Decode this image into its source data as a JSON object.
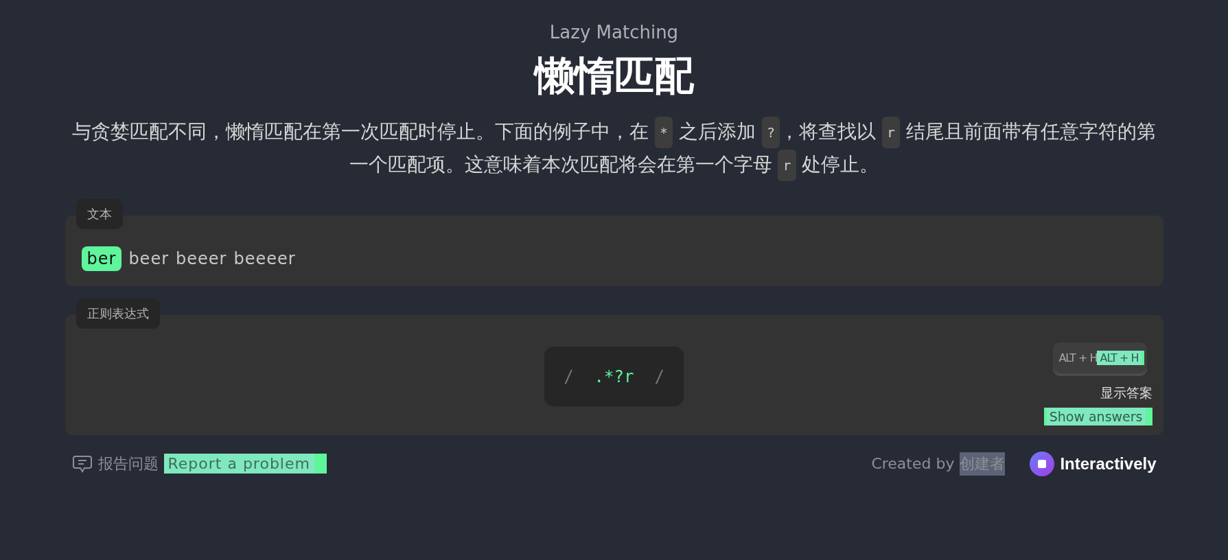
{
  "header": {
    "subtitle": "Lazy Matching",
    "title": "懒惰匹配",
    "description": [
      {
        "kind": "text",
        "text": "与贪婪匹配不同，懒惰匹配在第一次匹配时停止。下面的例子中，在 "
      },
      {
        "kind": "code",
        "text": "*"
      },
      {
        "kind": "text",
        "text": " 之后添加 "
      },
      {
        "kind": "code",
        "text": "?"
      },
      {
        "kind": "text",
        "text": "，将查找以 "
      },
      {
        "kind": "code",
        "text": "r"
      },
      {
        "kind": "text",
        "text": " 结尾且前面带有任意字符的第一个匹配项。这意味着本次匹配将会在第一个字母 "
      },
      {
        "kind": "code",
        "text": "r"
      },
      {
        "kind": "text",
        "text": " 处停止。"
      }
    ]
  },
  "text_panel": {
    "label": "文本",
    "tokens": [
      {
        "text": "ber",
        "matched": true
      },
      {
        "text": "beer",
        "matched": false
      },
      {
        "text": "beeer",
        "matched": false
      },
      {
        "text": "beeeer",
        "matched": false
      }
    ]
  },
  "regex_panel": {
    "label": "正则表达式",
    "delimiter_open": "/",
    "pattern": ".*?r",
    "delimiter_close": "/",
    "shortcut": {
      "keys": "ALT + H",
      "overlay": "ALT + H"
    },
    "show_answers": {
      "label": "显示答案",
      "overlay": "Show answers"
    }
  },
  "footer": {
    "report": {
      "label": "报告问题",
      "overlay": "Report a problem"
    },
    "credit": {
      "prefix": "Created by",
      "author": "创建者"
    },
    "brand": "Interactively"
  }
}
